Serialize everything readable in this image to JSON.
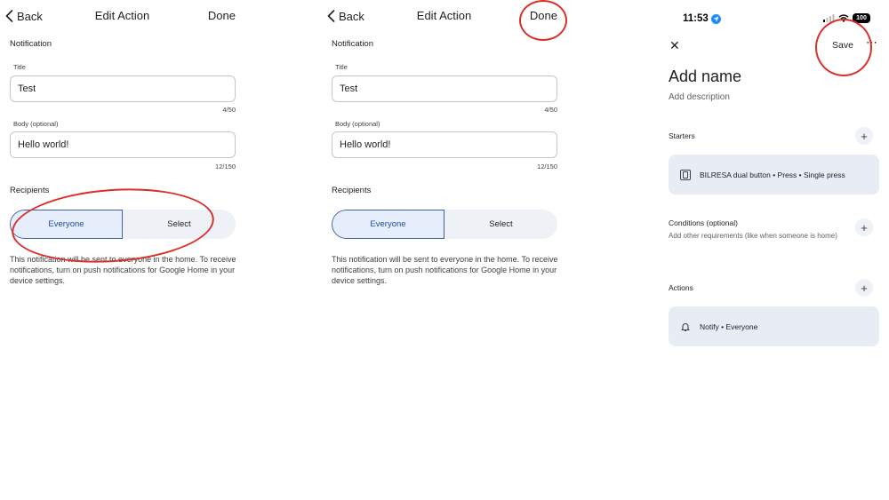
{
  "edit_action_1": {
    "back_label": "Back",
    "title": "Edit Action",
    "done_label": "Done",
    "section_notification": "Notification",
    "title_field_label": "Title",
    "title_field_value": "Test",
    "title_counter": "4/50",
    "body_field_label": "Body (optional)",
    "body_field_value": "Hello world!",
    "body_counter": "12/150",
    "section_recipients": "Recipients",
    "recipient_options": [
      "Everyone",
      "Select"
    ],
    "selected_recipient": "Everyone",
    "info_text": "This notification will be sent to everyone in the home. To receive notifications, turn on push notifications for Google Home in your device settings."
  },
  "edit_action_2": {
    "back_label": "Back",
    "title": "Edit Action",
    "done_label": "Done",
    "section_notification": "Notification",
    "title_field_label": "Title",
    "title_field_value": "Test",
    "title_counter": "4/50",
    "body_field_label": "Body (optional)",
    "body_field_value": "Hello world!",
    "body_counter": "12/150",
    "section_recipients": "Recipients",
    "recipient_options": [
      "Everyone",
      "Select"
    ],
    "selected_recipient": "Everyone",
    "info_text": "This notification will be sent to everyone in the home. To receive notifications, turn on push notifications for Google Home in your device settings."
  },
  "automation": {
    "status_time": "11:53",
    "battery": "100",
    "save_label": "Save",
    "name_placeholder": "Add name",
    "description_placeholder": "Add description",
    "starters_heading": "Starters",
    "starter_item": "BILRESA dual button • Press • Single press",
    "conditions_heading": "Conditions (optional)",
    "conditions_sub": "Add other requirements (like when someone is home)",
    "actions_heading": "Actions",
    "action_item": "Notify • Everyone"
  },
  "colors": {
    "highlight_circle": "#d9302a",
    "selected_segment_border": "#3b5fa8",
    "card_background": "#e8ecf4"
  }
}
